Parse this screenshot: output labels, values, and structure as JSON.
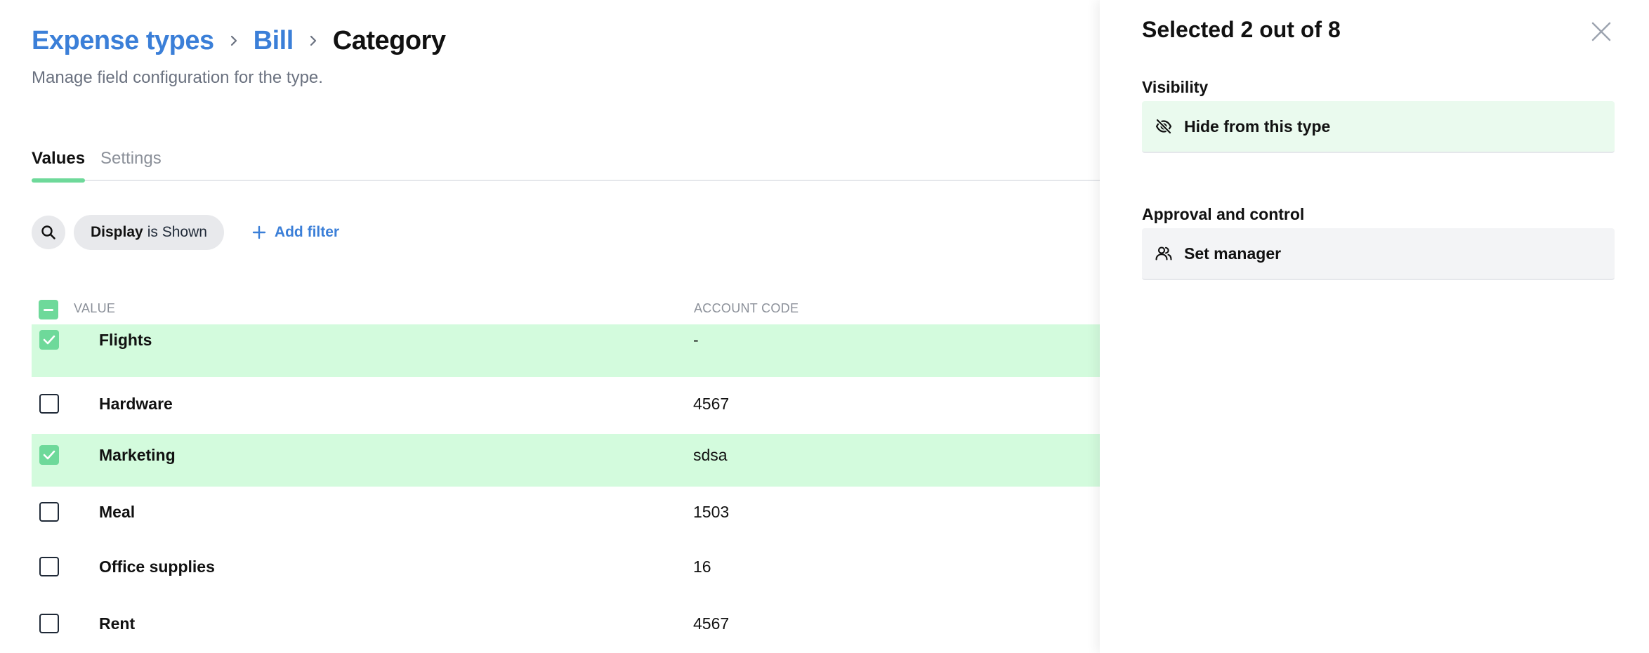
{
  "breadcrumb": {
    "items": [
      "Expense types",
      "Bill"
    ],
    "current": "Category"
  },
  "subtitle": "Manage field configuration for the type.",
  "tabs": {
    "active": "Values",
    "inactive": "Settings"
  },
  "filters": {
    "chip_field": "Display",
    "chip_rest": "is Shown",
    "add_filter": "Add filter"
  },
  "table": {
    "columns": [
      "VALUE",
      "ACCOUNT CODE"
    ],
    "rows": [
      {
        "value": "Flights",
        "code": "-",
        "selected": true
      },
      {
        "value": "Hardware",
        "code": "4567",
        "selected": false
      },
      {
        "value": "Marketing",
        "code": "sdsa",
        "selected": true
      },
      {
        "value": "Meal",
        "code": "1503",
        "selected": false
      },
      {
        "value": "Office supplies",
        "code": "16",
        "selected": false
      },
      {
        "value": "Rent",
        "code": "4567",
        "selected": false
      }
    ]
  },
  "panel": {
    "title": "Selected 2 out of 8",
    "visibility_label": "Visibility",
    "hide_action": "Hide from this type",
    "approval_label": "Approval and control",
    "manager_action": "Set manager"
  },
  "colors": {
    "accent_link": "#3b7fd8",
    "accent_green": "#6ed99a",
    "selected_row": "#d3fbdd"
  },
  "icons": [
    "chevron-right-icon",
    "search-icon",
    "plus-icon",
    "check-icon",
    "minus-icon",
    "close-icon",
    "eye-off-icon",
    "users-icon"
  ]
}
